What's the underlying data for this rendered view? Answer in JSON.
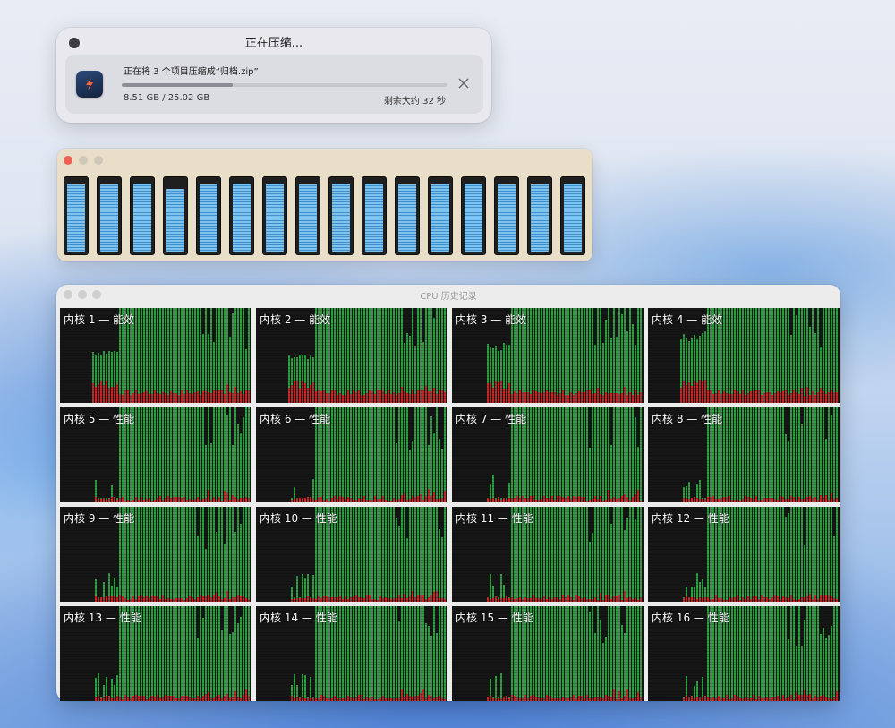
{
  "compress_window": {
    "title": "正在压缩...",
    "message": "正在将 3 个项目压缩成“归档.zip”",
    "size_text": "8.51 GB / 25.02 GB",
    "remaining_text": "剩余大约 32 秒",
    "progress": 0.34,
    "icon": "lightning-app-icon",
    "close_icon": "close-icon"
  },
  "cpu_window": {
    "gauges": [
      0.97,
      0.97,
      0.97,
      0.9,
      0.97,
      0.97,
      0.97,
      0.97,
      0.97,
      0.97,
      0.97,
      0.97,
      0.97,
      0.97,
      0.97,
      0.97
    ],
    "colors": {
      "fill": "#7ec3ee",
      "shade": "#3f90cd",
      "frame": "#1f1f1f"
    }
  },
  "history_window": {
    "title": "CPU 历史记录",
    "colors": {
      "user": "#2ea043",
      "system": "#c62a2a",
      "idle": "#161616"
    },
    "cores": [
      {
        "label": "内核 1 — 能效",
        "type": "e"
      },
      {
        "label": "内核 2 — 能效",
        "type": "e"
      },
      {
        "label": "内核 3 — 能效",
        "type": "e"
      },
      {
        "label": "内核 4 — 能效",
        "type": "e"
      },
      {
        "label": "内核 5 — 性能",
        "type": "p"
      },
      {
        "label": "内核 6 — 性能",
        "type": "p"
      },
      {
        "label": "内核 7 — 性能",
        "type": "p"
      },
      {
        "label": "内核 8 — 性能",
        "type": "p"
      },
      {
        "label": "内核 9 — 性能",
        "type": "p"
      },
      {
        "label": "内核 10 — 性能",
        "type": "p"
      },
      {
        "label": "内核 11 — 性能",
        "type": "p"
      },
      {
        "label": "内核 12 — 性能",
        "type": "p"
      },
      {
        "label": "内核 13 — 性能",
        "type": "p"
      },
      {
        "label": "内核 14 — 性能",
        "type": "p"
      },
      {
        "label": "内核 15 — 性能",
        "type": "p"
      },
      {
        "label": "内核 16 — 性能",
        "type": "p"
      }
    ]
  }
}
